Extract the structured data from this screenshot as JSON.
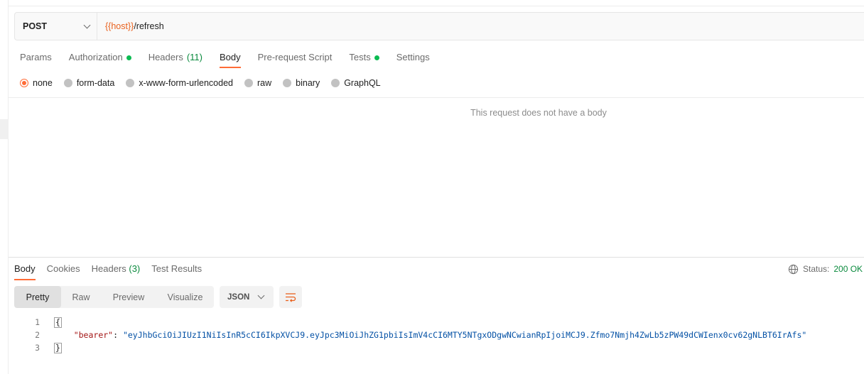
{
  "request": {
    "method": "POST",
    "url_var": "{{host}}",
    "url_path": "/refresh"
  },
  "request_tabs": [
    {
      "label": "Params"
    },
    {
      "label": "Authorization"
    },
    {
      "label": "Headers",
      "count": "(11)"
    },
    {
      "label": "Body"
    },
    {
      "label": "Pre-request Script"
    },
    {
      "label": "Tests"
    },
    {
      "label": "Settings"
    }
  ],
  "body_types": [
    "none",
    "form-data",
    "x-www-form-urlencoded",
    "raw",
    "binary",
    "GraphQL"
  ],
  "body_selected": "none",
  "no_body_message": "This request does not have a body",
  "response_tabs": [
    {
      "label": "Body"
    },
    {
      "label": "Cookies"
    },
    {
      "label": "Headers",
      "count": "(3)"
    },
    {
      "label": "Test Results"
    }
  ],
  "status": {
    "label": "Status:",
    "value": "200 OK"
  },
  "view_modes": [
    "Pretty",
    "Raw",
    "Preview",
    "Visualize"
  ],
  "format": "JSON",
  "code": {
    "line_numbers": [
      "1",
      "2",
      "3"
    ],
    "open_brace": "{",
    "key": "\"bearer\"",
    "colon": ": ",
    "value": "\"eyJhbGciOiJIUzI1NiIsInR5cCI6IkpXVCJ9.eyJpc3MiOiJhZG1pbiIsImV4cCI6MTY5NTgxODgwNCwianRpIjoiMCJ9.Zfmo7Nmjh4ZwLb5zPW49dCWIenx0cv62gNLBT6IrAfs\"",
    "close_brace": "}"
  },
  "colors": {
    "accent": "#ff6c37",
    "success": "#0cbb52",
    "url_var": "#e9611d"
  }
}
